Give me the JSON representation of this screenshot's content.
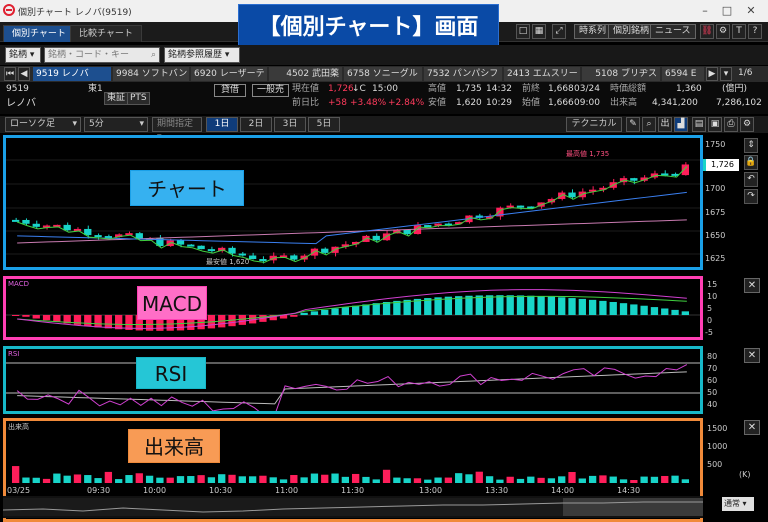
{
  "window": {
    "title": "個別チャート レノバ(9519)"
  },
  "banner": {
    "text": "【個別チャート】画面"
  },
  "tabs": [
    {
      "label": "個別チャート"
    },
    {
      "label": "比較チャート"
    }
  ],
  "toolbar": {
    "buttons": [
      "時系列",
      "個別銘柄",
      "ニュース"
    ],
    "help": "?"
  },
  "symbol_row": {
    "brand_label": "銘柄",
    "code_placeholder": "銘柄・コード・キー",
    "history_label": "銘柄参照履歴"
  },
  "stocks": [
    "9519 レノバ",
    "9984 ソフトバン",
    "6920 レーザーテ",
    "4502 武田薬",
    "6758 ソニーグル",
    "7532 パンパシフ",
    "2413 エムスリー",
    "5108 ブリヂス",
    "6594 E"
  ],
  "page_counter": "1/6",
  "quote": {
    "code": "9519",
    "name": "レノバ",
    "market": "東1",
    "tag1": "東証",
    "tag2": "PTS",
    "btn_credit": "貸借",
    "btn_general": "一般売",
    "current_label": "現在値",
    "current": "1,726",
    "current_arrow": "↓C",
    "current_time": "15:00",
    "prev_label": "前日比",
    "change": "+58",
    "change_pct": "+3.48%",
    "change_pct2": "+2.84%",
    "high_label": "高値",
    "high": "1,735",
    "high_time": "14:32",
    "low_label": "安値",
    "low": "1,620",
    "low_time": "10:29",
    "prevclose_label": "前終",
    "prevclose": "1,668",
    "prevclose_date": "03/24",
    "open_label": "始値",
    "open": "1,666",
    "open_time": "09:00",
    "mcap_label": "時価総額",
    "mcap": "1,360",
    "mcap_unit": "(億円)",
    "volume_label": "出来高",
    "volume": "4,341,200",
    "volume2": "7,286,102"
  },
  "controls": {
    "chart_type": "ローソク足",
    "interval": "5分",
    "period": "期間指定",
    "ranges": [
      "1日",
      "2日",
      "3日",
      "5日"
    ],
    "active_range": "1日",
    "technical": "テクニカル"
  },
  "panels": {
    "chart": "チャート",
    "macd": "MACD",
    "rsi": "RSI",
    "volume": "出来高"
  },
  "panel_labels": {
    "macd": "MACD",
    "rsi": "RSI",
    "volume": "出来高"
  },
  "chart_annotations": {
    "high": "最高値 1,735",
    "low": "最安値 1,620",
    "last_price": "1,726"
  },
  "price_axis": [
    "1750",
    "1725",
    "1700",
    "1675",
    "1650",
    "1625"
  ],
  "macd_axis": [
    "15",
    "10",
    "5",
    "0",
    "-5"
  ],
  "rsi_axis": [
    "80",
    "70",
    "60",
    "50",
    "40"
  ],
  "volume_axis": [
    "1500",
    "1000",
    "500"
  ],
  "volume_unit": "(K)",
  "time_axis": [
    "03/25",
    "09:30",
    "10:00",
    "10:30",
    "11:00",
    "11:30",
    "13:00",
    "13:30",
    "14:00",
    "14:30"
  ],
  "nav": {
    "mode": "通常"
  },
  "colors": {
    "chart_border": "#1aa0e8",
    "macd_border": "#ff3fb4",
    "rsi_border": "#17b8c8",
    "volume_border": "#f08a3a",
    "up": "#18d4c8",
    "down": "#ff1e5a",
    "banner": "#0a4aa6"
  }
}
